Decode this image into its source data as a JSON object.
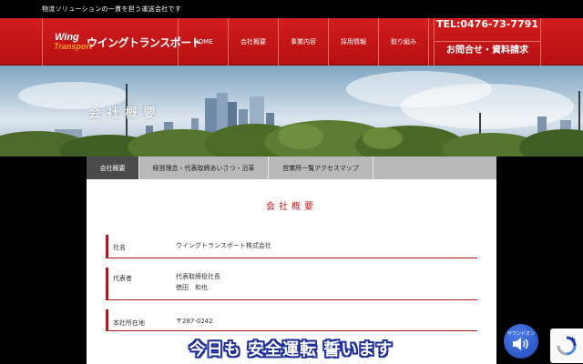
{
  "topbar": {
    "tagline": "物流ソリューションの一貫を担う運送会社です"
  },
  "logo": {
    "wing": "Wing",
    "transport": "Transport",
    "kana": "ウイングトランスポート"
  },
  "nav": {
    "items": [
      "HOME",
      "会社概要",
      "事業内容",
      "採用情報",
      "取り組み"
    ]
  },
  "contact": {
    "tel": "TEL:0476-73-7791",
    "inquiry": "お問合せ・資料請求"
  },
  "hero": {
    "title": "会社概要"
  },
  "tabs": [
    "会社概要",
    "経営理念・代表取締あいさつ・沿革",
    "営業所一覧アクセスマップ"
  ],
  "content": {
    "section_title": "会社概要",
    "rows": [
      {
        "label": "社名",
        "value": "ウイングトランスポート株式会社"
      },
      {
        "label": "代表者",
        "value_line1": "代表取締役社長",
        "value_line2": "徳田　和也"
      },
      {
        "label": "本社所在地",
        "value": "〒287-0242"
      }
    ]
  },
  "banner": {
    "text": "今日も 安全運転  誓います"
  },
  "sound_button": {
    "label": "サウンドオン",
    "icon": "speaker-icon"
  },
  "recaptcha": {
    "icon": "recaptcha-icon"
  },
  "colors": {
    "brand_red": "#c91818",
    "banner_blue": "#1e2f9a",
    "tab_active": "#4a4a4a"
  }
}
